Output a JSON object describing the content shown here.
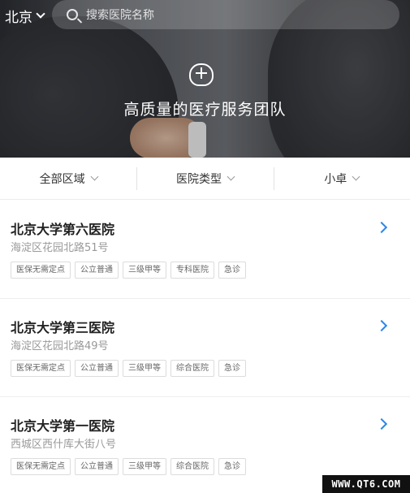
{
  "header": {
    "city": "北京",
    "search_placeholder": "搜索医院名称",
    "banner_title": "高质量的医疗服务团队"
  },
  "filters": [
    {
      "label": "全部区域"
    },
    {
      "label": "医院类型"
    },
    {
      "label": "小卓"
    }
  ],
  "hospitals": [
    {
      "name": "北京大学第六医院",
      "address": "海淀区花园北路51号",
      "tags": [
        "医保无需定点",
        "公立普通",
        "三级甲等",
        "专科医院",
        "急诊"
      ]
    },
    {
      "name": "北京大学第三医院",
      "address": "海淀区花园北路49号",
      "tags": [
        "医保无需定点",
        "公立普通",
        "三级甲等",
        "综合医院",
        "急诊"
      ]
    },
    {
      "name": "北京大学第一医院",
      "address": "西城区西什库大街八号",
      "tags": [
        "医保无需定点",
        "公立普通",
        "三级甲等",
        "综合医院",
        "急诊"
      ]
    }
  ],
  "watermark": "WWW.QT6.COM",
  "colors": {
    "accent": "#2b87e8",
    "tag_border": "#dcdcdc",
    "address_text": "#999999"
  }
}
